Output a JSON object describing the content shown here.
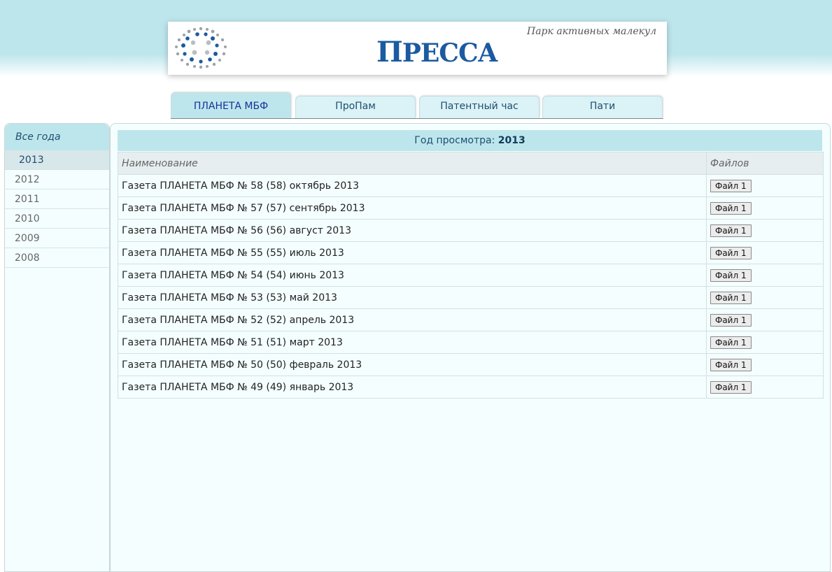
{
  "header": {
    "slogan": "Парк активных малекул",
    "brand_initial": "П",
    "brand_rest": "РЕССА"
  },
  "tabs": [
    {
      "label": "ПЛАНЕТА МБФ",
      "active": true
    },
    {
      "label": "ПроПам",
      "active": false
    },
    {
      "label": "Патентный час",
      "active": false
    },
    {
      "label": "Пати",
      "active": false
    }
  ],
  "sidebar": {
    "title": "Все года",
    "years": [
      "2013",
      "2012",
      "2011",
      "2010",
      "2009",
      "2008"
    ],
    "selected": "2013"
  },
  "main": {
    "year_label": "Год просмотра:",
    "year_value": "2013",
    "columns": {
      "name": "Наименование",
      "files": "Файлов"
    },
    "rows": [
      {
        "name": "Газета ПЛАНЕТА МБФ № 58 (58) октябрь 2013",
        "file": "Файл 1"
      },
      {
        "name": "Газета ПЛАНЕТА МБФ № 57 (57) сентябрь 2013",
        "file": "Файл 1"
      },
      {
        "name": "Газета ПЛАНЕТА МБФ № 56 (56) август 2013",
        "file": "Файл 1"
      },
      {
        "name": "Газета ПЛАНЕТА МБФ № 55 (55) июль 2013",
        "file": "Файл 1"
      },
      {
        "name": "Газета ПЛАНЕТА МБФ № 54 (54) июнь 2013",
        "file": "Файл 1"
      },
      {
        "name": "Газета ПЛАНЕТА МБФ № 53 (53) май 2013",
        "file": "Файл 1"
      },
      {
        "name": "Газета ПЛАНЕТА МБФ № 52 (52) апрель 2013",
        "file": "Файл 1"
      },
      {
        "name": "Газета ПЛАНЕТА МБФ № 51 (51) март 2013",
        "file": "Файл 1"
      },
      {
        "name": "Газета ПЛАНЕТА МБФ № 50 (50) февраль 2013",
        "file": "Файл 1"
      },
      {
        "name": "Газета ПЛАНЕТА МБФ № 49 (49) январь 2013",
        "file": "Файл 1"
      }
    ]
  },
  "colors": {
    "accent": "#bde6ec",
    "brand": "#1b5aa0",
    "panel": "#f4fefe"
  }
}
